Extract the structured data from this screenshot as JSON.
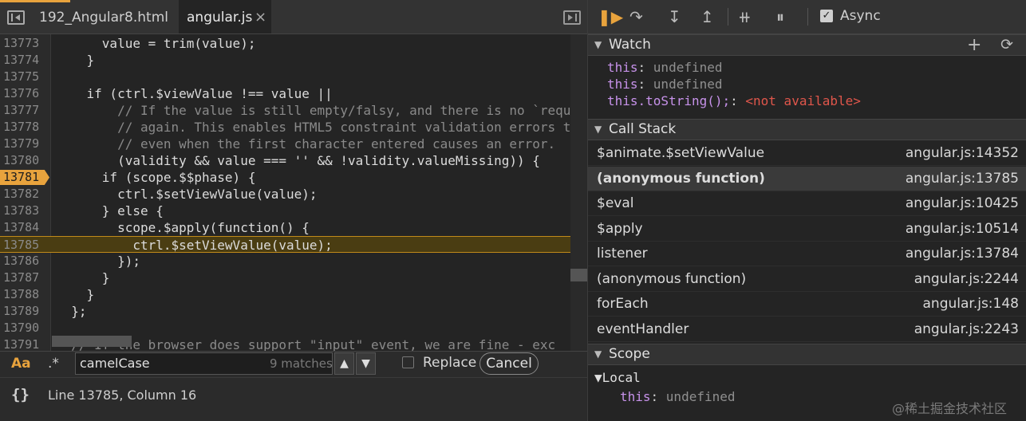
{
  "editor": {
    "tabs": [
      {
        "label": "192_Angular8.html"
      },
      {
        "label": "angular.js",
        "close": "×"
      }
    ],
    "lines": [
      {
        "n": "13773",
        "t": "      value = trim(value);"
      },
      {
        "n": "13774",
        "t": "    }"
      },
      {
        "n": "13775",
        "t": ""
      },
      {
        "n": "13776",
        "t": "    if (ctrl.$viewValue !== value ||"
      },
      {
        "n": "13777",
        "t": "        // If the value is still empty/falsy, and there is no `requ"
      },
      {
        "n": "13778",
        "t": "        // again. This enables HTML5 constraint validation errors t"
      },
      {
        "n": "13779",
        "t": "        // even when the first character entered causes an error."
      },
      {
        "n": "13780",
        "t": "        (validity && value === '' && !validity.valueMissing)) {"
      },
      {
        "n": "13781",
        "t": "      if (scope.$$phase) {"
      },
      {
        "n": "13782",
        "t": "        ctrl.$setViewValue(value);"
      },
      {
        "n": "13783",
        "t": "      } else {"
      },
      {
        "n": "13784",
        "t": "        scope.$apply(function() {"
      },
      {
        "n": "13785",
        "t": "          ctrl.$setViewValue(value);"
      },
      {
        "n": "13786",
        "t": "        });"
      },
      {
        "n": "13787",
        "t": "      }"
      },
      {
        "n": "13788",
        "t": "    }"
      },
      {
        "n": "13789",
        "t": "  };"
      },
      {
        "n": "13790",
        "t": ""
      },
      {
        "n": "13791",
        "t": "  // If the browser does support \"input\" event, we are fine - exc"
      }
    ],
    "breakpoint_line": "13781",
    "current_line": "13785"
  },
  "search": {
    "match_case": "Aa",
    "regex": ".*",
    "query": "camelCase",
    "matches": "9 matches",
    "replace_label": "Replace",
    "cancel_label": "Cancel"
  },
  "status": {
    "braces": "{}",
    "position": "Line 13785, Column 16"
  },
  "debugger": {
    "async_label": "Async",
    "async_check": "✓"
  },
  "watch": {
    "title": "Watch",
    "items": [
      {
        "name": "this",
        "sep": ": ",
        "value": "undefined"
      },
      {
        "name": "this",
        "sep": ": ",
        "value": "undefined"
      },
      {
        "name": "this.toString();",
        "sep": ": ",
        "value": "<not available>"
      }
    ]
  },
  "call_stack": {
    "title": "Call Stack",
    "frames": [
      {
        "fn": "$animate.$setViewValue",
        "loc": "angular.js:14352"
      },
      {
        "fn": "(anonymous function)",
        "loc": "angular.js:13785"
      },
      {
        "fn": "$eval",
        "loc": "angular.js:10425"
      },
      {
        "fn": "$apply",
        "loc": "angular.js:10514"
      },
      {
        "fn": "listener",
        "loc": "angular.js:13784"
      },
      {
        "fn": "(anonymous function)",
        "loc": "angular.js:2244"
      },
      {
        "fn": "forEach",
        "loc": "angular.js:148"
      },
      {
        "fn": "eventHandler",
        "loc": "angular.js:2243"
      }
    ],
    "selected_index": 1
  },
  "scope": {
    "title": "Scope",
    "local_label": "Local",
    "local_items": [
      {
        "name": "this",
        "sep": ": ",
        "value": "undefined"
      }
    ]
  },
  "watermark": "@稀土掘金技术社区"
}
